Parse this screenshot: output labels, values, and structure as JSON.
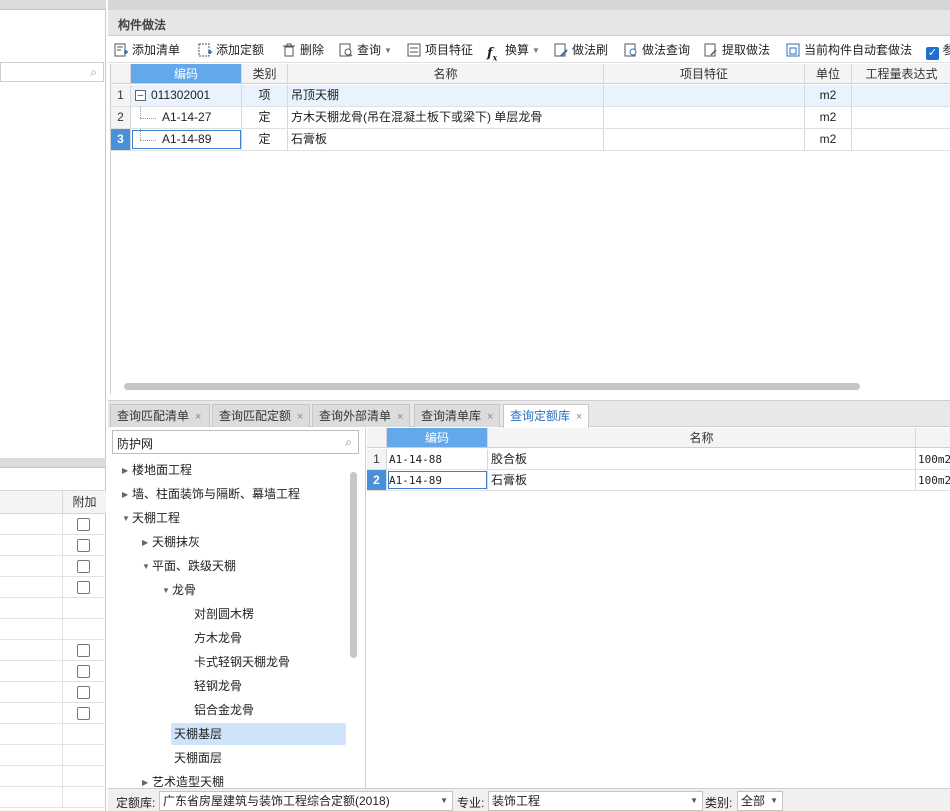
{
  "panel": {
    "title": "构件做法"
  },
  "toolbar": {
    "add_list": "添加清单",
    "add_quota": "添加定额",
    "delete": "删除",
    "query": "查询",
    "item_feature": "项目特征",
    "convert": "换算",
    "method_brush": "做法刷",
    "method_query": "做法查询",
    "extract_method": "提取做法",
    "auto_apply": "当前构件自动套做法",
    "cut_label": "参"
  },
  "upper_grid": {
    "headers": {
      "code": "编码",
      "category": "类别",
      "name": "名称",
      "feature": "项目特征",
      "unit": "单位",
      "expr": "工程量表达式"
    },
    "rows": [
      {
        "num": "1",
        "code": "011302001",
        "category": "项",
        "name": "吊顶天棚",
        "feature": "",
        "unit": "m2"
      },
      {
        "num": "2",
        "code": "A1-14-27",
        "category": "定",
        "name": "方木天棚龙骨(吊在混凝土板下或梁下) 单层龙骨",
        "feature": "",
        "unit": "m2"
      },
      {
        "num": "3",
        "code": "A1-14-89",
        "category": "定",
        "name": "石膏板",
        "feature": "",
        "unit": "m2"
      }
    ]
  },
  "tabs": [
    {
      "label": "查询匹配清单"
    },
    {
      "label": "查询匹配定额"
    },
    {
      "label": "查询外部清单"
    },
    {
      "label": "查询清单库"
    },
    {
      "label": "查询定额库"
    }
  ],
  "tree": {
    "search_value": "防护网",
    "nodes": [
      {
        "label": "楼地面工程"
      },
      {
        "label": "墙、柱面装饰与隔断、幕墙工程"
      },
      {
        "label": "天棚工程"
      },
      {
        "label": "天棚抹灰"
      },
      {
        "label": "平面、跌级天棚"
      },
      {
        "label": "龙骨"
      },
      {
        "label": "对剖圆木楞"
      },
      {
        "label": "方木龙骨"
      },
      {
        "label": "卡式轻钢天棚龙骨"
      },
      {
        "label": "轻钢龙骨"
      },
      {
        "label": "铝合金龙骨"
      },
      {
        "label": "天棚基层"
      },
      {
        "label": "天棚面层"
      },
      {
        "label": "艺术造型天棚"
      }
    ]
  },
  "lower_grid": {
    "headers": {
      "code": "编码",
      "name": "名称"
    },
    "rows": [
      {
        "num": "1",
        "code": "A1-14-88",
        "name": "胶合板",
        "unit": "100m2"
      },
      {
        "num": "2",
        "code": "A1-14-89",
        "name": "石膏板",
        "unit": "100m2"
      }
    ]
  },
  "left_pane": {
    "extra_header": "附加"
  },
  "bottom_bar": {
    "quota_lib_label": "定额库:",
    "quota_lib_value": "广东省房屋建筑与装饰工程综合定额(2018)",
    "specialty_label": "专业:",
    "specialty_value": "装饰工程",
    "category_label": "类别:",
    "category_value": "全部"
  },
  "colors": {
    "accent": "#4a90d9",
    "header_highlight": "#63a8ea",
    "tree_selection": "#cfe3fb"
  }
}
